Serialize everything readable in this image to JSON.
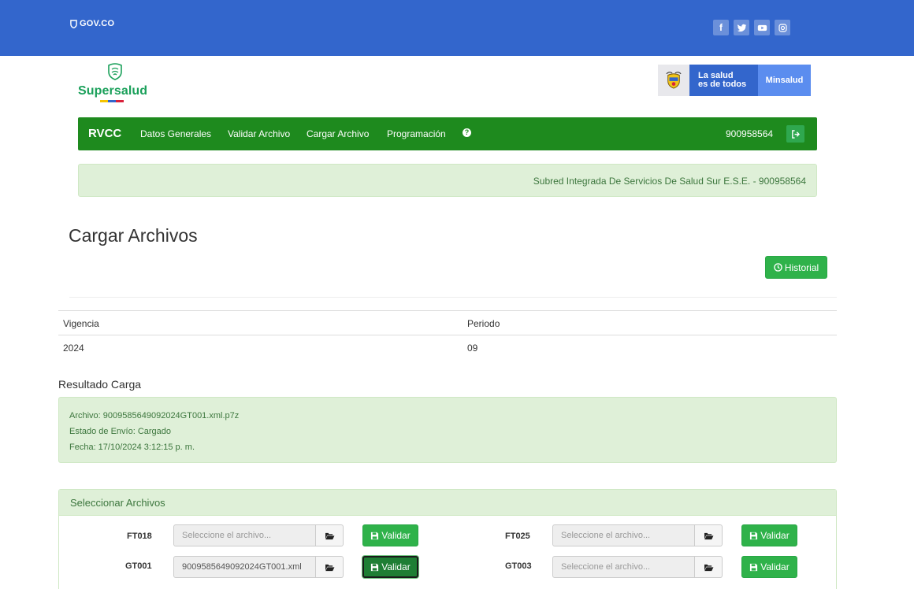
{
  "gov": {
    "logo": "GOV.CO"
  },
  "social": [
    {
      "name": "facebook-icon",
      "glyph": "f"
    },
    {
      "name": "twitter-icon"
    },
    {
      "name": "youtube-icon"
    },
    {
      "name": "instagram-icon"
    }
  ],
  "brand": {
    "name": "Supersalud"
  },
  "minsalud": {
    "slogan_line1": "La salud",
    "slogan_line2": "es de todos",
    "label": "Minsalud"
  },
  "navbar": {
    "brand": "RVCC",
    "items": [
      "Datos Generales",
      "Validar Archivo",
      "Cargar Archivo",
      "Programación"
    ],
    "help": "?",
    "nit": "900958564"
  },
  "entity": {
    "text": "Subred Integrada De Servicios De Salud Sur E.S.E. - 900958564"
  },
  "page": {
    "title": "Cargar Archivos",
    "historial_label": "Historial"
  },
  "vigencia_table": {
    "headers": [
      "Vigencia",
      "Periodo"
    ],
    "values": [
      "2024",
      "09"
    ]
  },
  "resultado": {
    "title": "Resultado Carga",
    "archivo": "Archivo: 9009585649092024GT001.xml.p7z",
    "estado": "Estado de Envío: Cargado",
    "fecha": "Fecha: 17/10/2024 3:12:15 p. m."
  },
  "panel": {
    "title": "Seleccionar Archivos",
    "validar_label": "Validar",
    "files": [
      {
        "code": "FT018",
        "value": "",
        "placeholder": "Seleccione el archivo..."
      },
      {
        "code": "FT025",
        "value": "",
        "placeholder": "Seleccione el archivo..."
      },
      {
        "code": "GT001",
        "value": "9009585649092024GT001.xml",
        "placeholder": "Seleccione el archivo..."
      },
      {
        "code": "GT003",
        "value": "",
        "placeholder": "Seleccione el archivo..."
      }
    ]
  },
  "colors": {
    "gov_blue": "#3366cc",
    "nav_green": "#1e8a1e",
    "button_green": "#2fb24a",
    "alert_bg": "#dff0d8",
    "alert_text": "#3c763d"
  }
}
